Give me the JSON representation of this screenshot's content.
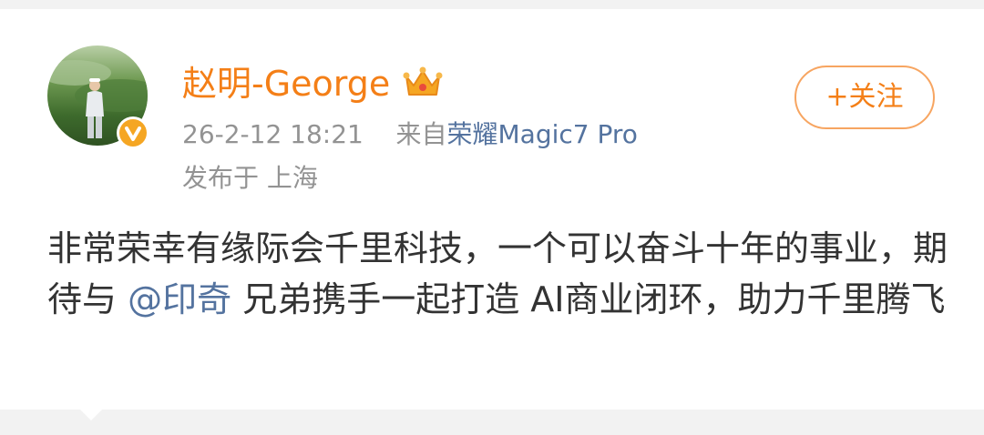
{
  "post": {
    "author": {
      "name": "赵明-George",
      "avatar_icon": "avatar-photo",
      "verified_icon": "verified-badge-icon",
      "member_icon": "crown-icon"
    },
    "timestamp": "26-2-12 18:21",
    "source_prefix": "来自",
    "device": "荣耀Magic7 Pro",
    "location": "发布于 上海",
    "follow_label": "+关注",
    "content": {
      "text_1": "非常荣幸有缘际会千里科技，一个可以奋斗十年的事业，期待与 ",
      "mention": "@印奇",
      "text_2": " 兄弟携手一起打造 AI商业闭环，助力千里腾飞"
    }
  },
  "colors": {
    "accent_orange": "#f47f17",
    "link_blue": "#54739f",
    "meta_gray": "#939393",
    "text_dark": "#333333",
    "verified_gold": "#f5a623"
  }
}
